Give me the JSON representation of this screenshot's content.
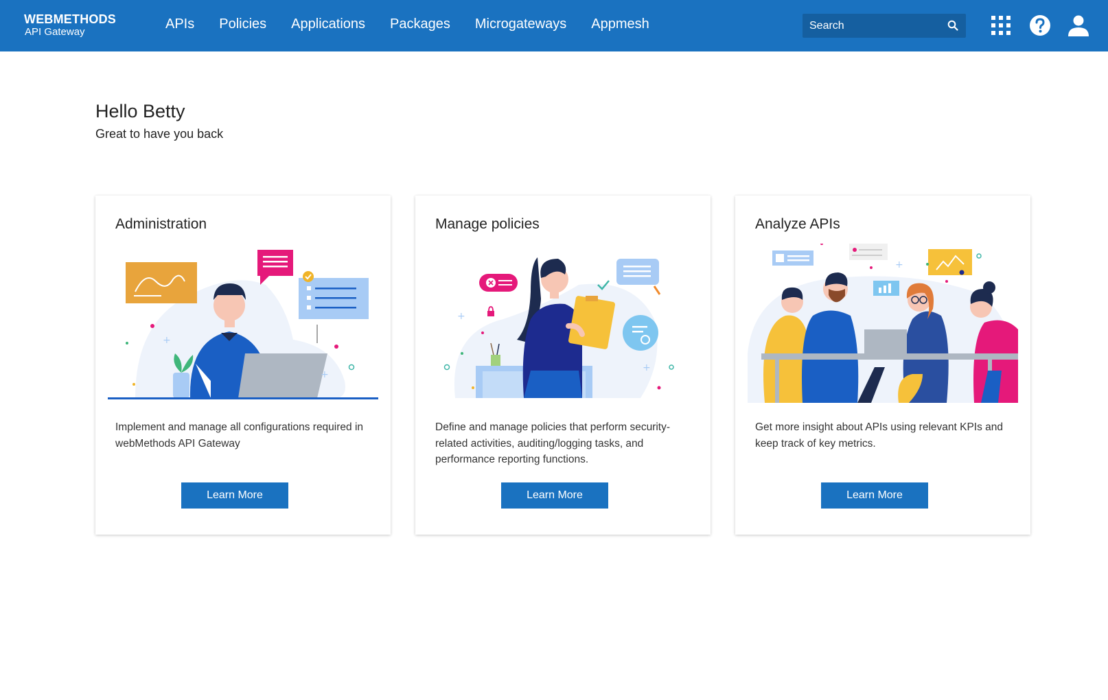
{
  "brand": {
    "name": "WEBMETHODS",
    "product": "API Gateway"
  },
  "nav": {
    "items": [
      "APIs",
      "Policies",
      "Applications",
      "Packages",
      "Microgateways",
      "Appmesh"
    ]
  },
  "search": {
    "placeholder": "Search"
  },
  "header_icons": [
    "apps-grid-icon",
    "help-icon",
    "user-icon"
  ],
  "greeting": {
    "title": "Hello Betty",
    "subtitle": "Great to have you back"
  },
  "cards": [
    {
      "title": "Administration",
      "description": "Implement and manage all configurations required in webMethods API Gateway",
      "button": "Learn More"
    },
    {
      "title": "Manage policies",
      "description": "Define and manage policies that perform security-related activities, auditing/logging tasks, and performance reporting functions.",
      "button": "Learn More"
    },
    {
      "title": "Analyze APIs",
      "description": "Get more insight about APIs using relevant KPIs and keep track of key metrics.",
      "button": "Learn More"
    }
  ],
  "colors": {
    "header": "#1a72c0",
    "button": "#1a72c0",
    "search_bg": "#155fa0"
  }
}
